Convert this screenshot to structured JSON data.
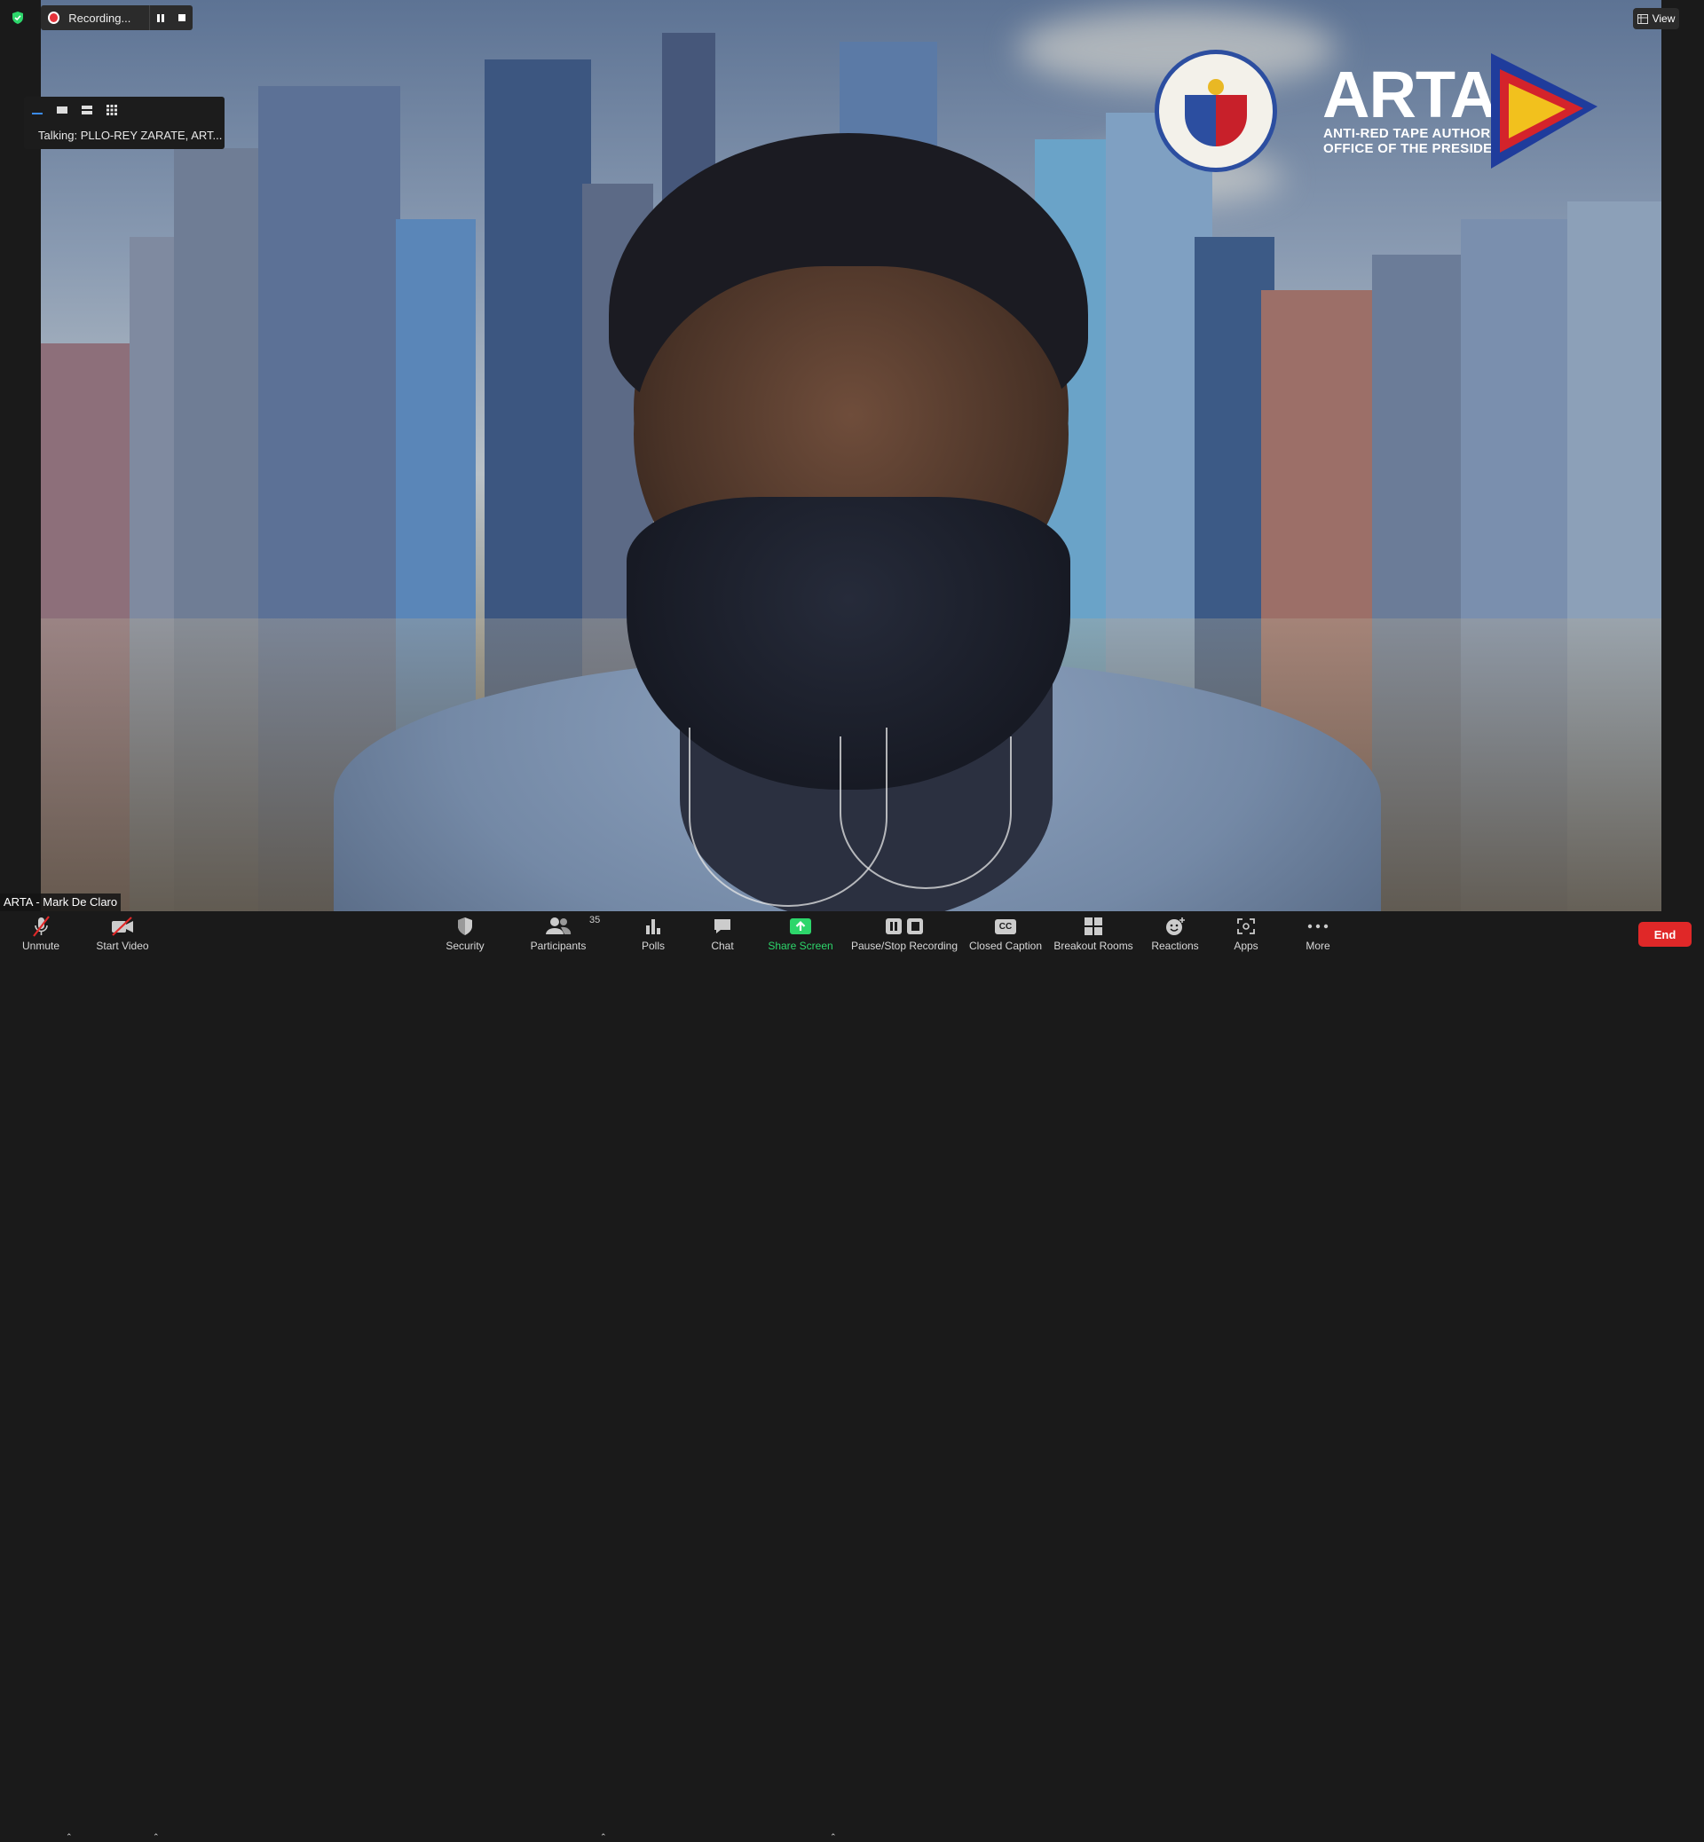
{
  "recording": {
    "status_text": "Recording..."
  },
  "view_button": {
    "label": "View"
  },
  "talking": {
    "text": "Talking: PLLO-REY ZARATE, ART..."
  },
  "logo": {
    "arta_text": "ARTA",
    "arta_line1": "ANTI-RED TAPE AUTHORITY",
    "arta_line2": "OFFICE OF THE PRESIDENT"
  },
  "participant": {
    "name_label": "ARTA - Mark De Claro"
  },
  "toolbar": {
    "unmute": "Unmute",
    "start_video": "Start Video",
    "security": "Security",
    "participants": "Participants",
    "participants_count": "35",
    "polls": "Polls",
    "chat": "Chat",
    "share_screen": "Share Screen",
    "pause_stop_recording": "Pause/Stop Recording",
    "closed_caption": "Closed Caption",
    "closed_caption_icon_text": "CC",
    "breakout_rooms": "Breakout Rooms",
    "reactions": "Reactions",
    "apps": "Apps",
    "more": "More",
    "end": "End"
  },
  "colors": {
    "toolbar_bg": "#1a1a1a",
    "end_red": "#e02828",
    "share_green": "#2dd66b",
    "recording_red": "#e5333b",
    "security_green": "#2dd66b"
  }
}
